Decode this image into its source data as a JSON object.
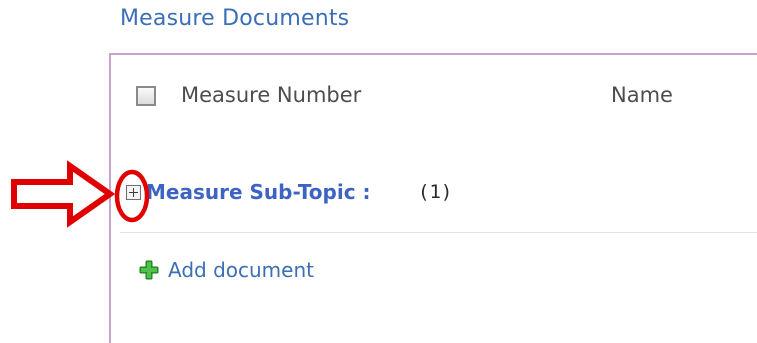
{
  "webpart": {
    "title": "Measure Documents"
  },
  "table": {
    "columns": [
      "Measure Number",
      "Name"
    ]
  },
  "group": {
    "label": "Measure Sub-Topic :",
    "count": "(1)",
    "expand_icon": "plus-box-icon"
  },
  "actions": {
    "add_document_label": "Add document",
    "add_icon": "green-plus-icon"
  },
  "annotation": {
    "arrow_color": "#e00000",
    "circle_color": "#e00000"
  },
  "colors": {
    "title": "#3b6fb5",
    "group_label": "#3d64c2",
    "panel_border": "#c8a2cc",
    "add_icon": "#2da12d"
  }
}
